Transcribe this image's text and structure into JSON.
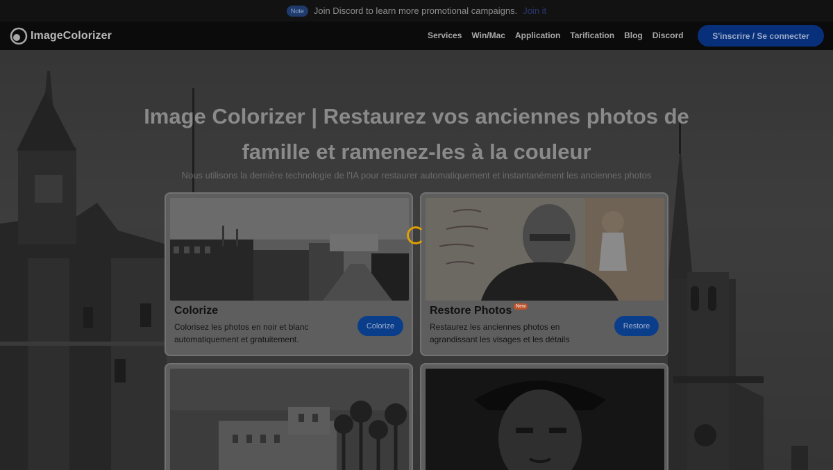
{
  "announcement": {
    "badge": "Note",
    "text": "Join Discord to learn more promotional campaigns.",
    "link": "Join it"
  },
  "nav": {
    "brand": "ImageColorizer",
    "links": [
      "Services",
      "Win/Mac",
      "Application",
      "Tarification",
      "Blog",
      "Discord"
    ],
    "cta": "S'inscrire / Se connecter"
  },
  "hero": {
    "title": "Image Colorizer | Restaurez vos anciennes photos de famille et ramenez-les à la couleur",
    "subtitle": "Nous utilisons la dernière technologie de l'IA pour restaurer automatiquement et instantanément les anciennes photos"
  },
  "cards": [
    {
      "title": "Colorize",
      "description": "Colorisez les photos en noir et blanc automatiquement et gratuitement.",
      "button": "Colorize"
    },
    {
      "title": "Restore Photos",
      "badge": "New",
      "description": "Restaurez les anciennes photos en agrandissant les visages et les détails",
      "button": "Restore"
    }
  ],
  "colors": {
    "accent": "#0b3e8a",
    "spinner": "#e0a000",
    "badge_new": "#c0522a"
  }
}
